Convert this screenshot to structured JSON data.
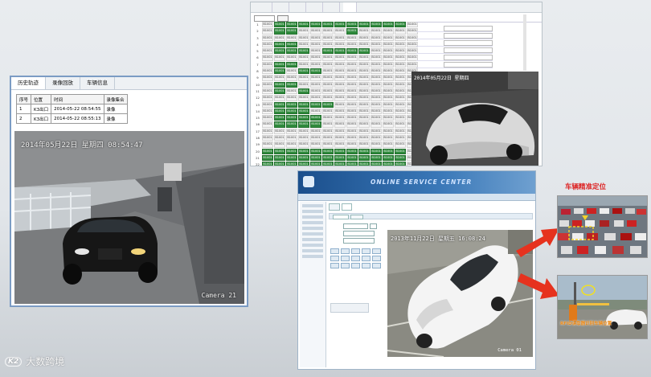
{
  "top_window": {
    "tabs": [
      "",
      "",
      "",
      "",
      "",
      ""
    ],
    "grid": {
      "rows": 23,
      "cols": 13,
      "slot_cells": "B1001",
      "green_slots": [
        [
          0,
          1,
          1,
          1,
          1,
          1,
          1,
          1,
          1,
          1,
          1,
          1,
          0
        ],
        [
          0,
          1,
          1,
          0,
          0,
          0,
          0,
          1,
          0,
          0,
          0,
          0,
          0
        ],
        [
          0,
          0,
          0,
          0,
          0,
          0,
          0,
          0,
          0,
          0,
          0,
          0,
          0
        ],
        [
          0,
          1,
          1,
          0,
          0,
          0,
          0,
          0,
          0,
          0,
          0,
          0,
          0
        ],
        [
          0,
          1,
          1,
          1,
          0,
          1,
          1,
          1,
          1,
          0,
          0,
          0,
          0
        ],
        [
          0,
          0,
          0,
          0,
          0,
          0,
          0,
          0,
          0,
          0,
          0,
          0,
          0
        ],
        [
          0,
          1,
          1,
          0,
          0,
          0,
          0,
          0,
          0,
          0,
          0,
          0,
          0
        ],
        [
          0,
          1,
          0,
          1,
          1,
          0,
          0,
          0,
          0,
          0,
          0,
          0,
          0
        ],
        [
          0,
          0,
          0,
          0,
          0,
          0,
          0,
          0,
          0,
          0,
          0,
          0,
          0
        ],
        [
          0,
          1,
          1,
          0,
          0,
          0,
          0,
          0,
          0,
          0,
          0,
          0,
          0
        ],
        [
          0,
          1,
          0,
          1,
          0,
          0,
          0,
          0,
          0,
          0,
          0,
          0,
          0
        ],
        [
          0,
          0,
          0,
          0,
          0,
          0,
          0,
          0,
          0,
          0,
          0,
          0,
          0
        ],
        [
          0,
          1,
          1,
          1,
          1,
          1,
          0,
          0,
          0,
          0,
          0,
          0,
          0
        ],
        [
          0,
          1,
          1,
          1,
          0,
          0,
          0,
          0,
          0,
          0,
          0,
          0,
          0
        ],
        [
          0,
          1,
          1,
          1,
          1,
          0,
          0,
          0,
          0,
          0,
          0,
          0,
          0
        ],
        [
          0,
          1,
          1,
          1,
          1,
          0,
          0,
          0,
          0,
          0,
          0,
          0,
          0
        ],
        [
          0,
          0,
          0,
          0,
          0,
          0,
          0,
          0,
          0,
          0,
          0,
          0,
          0
        ],
        [
          0,
          0,
          0,
          0,
          0,
          0,
          0,
          0,
          0,
          0,
          0,
          0,
          0
        ],
        [
          0,
          0,
          0,
          0,
          0,
          0,
          0,
          0,
          0,
          0,
          0,
          0,
          0
        ],
        [
          1,
          1,
          1,
          1,
          1,
          1,
          1,
          1,
          1,
          1,
          1,
          1,
          0
        ],
        [
          1,
          1,
          1,
          1,
          1,
          1,
          1,
          1,
          1,
          1,
          1,
          1,
          0
        ],
        [
          1,
          1,
          1,
          1,
          1,
          1,
          1,
          1,
          1,
          1,
          1,
          1,
          0
        ],
        [
          1,
          1,
          1,
          1,
          1,
          1,
          1,
          1,
          1,
          1,
          1,
          1,
          0
        ]
      ]
    },
    "camera_osd": "2014年05月22日  星期四"
  },
  "history_window": {
    "tabs": [
      "历史轨迹",
      "录像回放",
      "车辆信息"
    ],
    "table": {
      "headers": [
        "序号",
        "位置",
        "时间",
        "录像集合"
      ],
      "rows": [
        [
          "1",
          "K3出口",
          "2014-05-22 08:54:55",
          "录像"
        ],
        [
          "2",
          "K3出口",
          "2014-05-22 08:55:13",
          "录像"
        ]
      ]
    },
    "camera": {
      "osd": "2014年05月22日  星期四  08:54:47",
      "label": "Camera 21"
    }
  },
  "service_window": {
    "brand": "ONLINE SERVICE CENTER",
    "camera": {
      "osd": "2013年11月22日  星期五  16:08:24",
      "label": "Camera 01"
    }
  },
  "annotations": {
    "vehicle_locating_title": "车辆精准定位",
    "rfid_caption": "RFID读取器识别车辆位置"
  },
  "watermark": {
    "logo": "K2",
    "text": "大数跨境"
  },
  "colors": {
    "slot_green": "#2f8a3c",
    "arrow_red": "#e6321e",
    "frame_blue": "#7b9cc4"
  }
}
